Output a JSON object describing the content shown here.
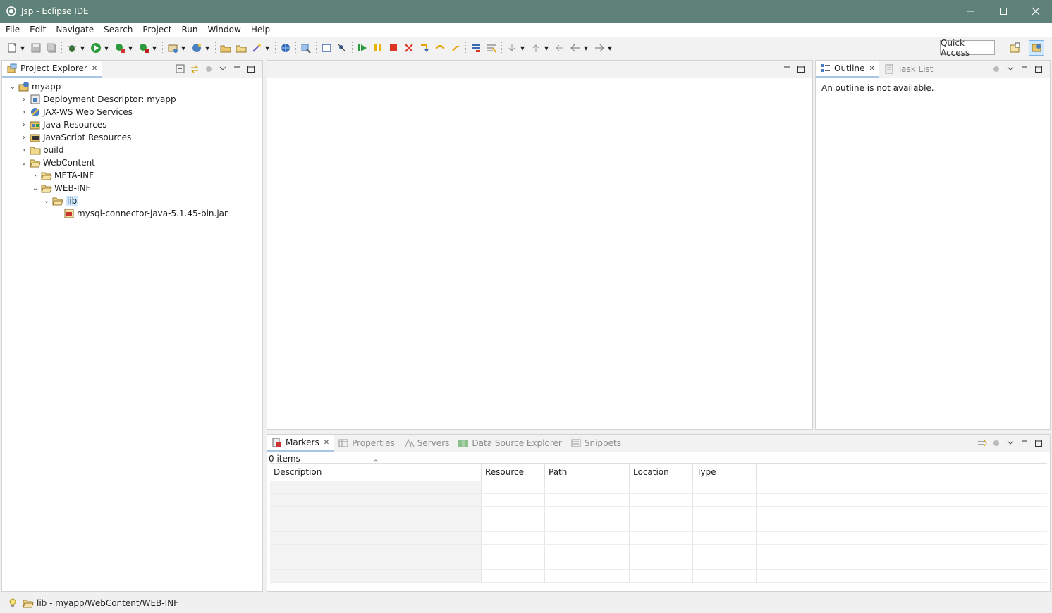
{
  "window": {
    "title": "Jsp - Eclipse IDE",
    "controls": [
      "minimize",
      "maximize",
      "close"
    ]
  },
  "menu": [
    "File",
    "Edit",
    "Navigate",
    "Search",
    "Project",
    "Run",
    "Window",
    "Help"
  ],
  "toolbar": {
    "quick_access": "Quick Access"
  },
  "project_explorer": {
    "tab_label": "Project Explorer",
    "tree": [
      {
        "label": "myapp",
        "depth": 0,
        "expanded": true,
        "icon": "project-icon"
      },
      {
        "label": "Deployment Descriptor: myapp",
        "depth": 1,
        "expanded": false,
        "icon": "descriptor-icon"
      },
      {
        "label": "JAX-WS Web Services",
        "depth": 1,
        "expanded": false,
        "icon": "webservice-icon"
      },
      {
        "label": "Java Resources",
        "depth": 1,
        "expanded": false,
        "icon": "java-resources-icon"
      },
      {
        "label": "JavaScript Resources",
        "depth": 1,
        "expanded": false,
        "icon": "js-resources-icon"
      },
      {
        "label": "build",
        "depth": 1,
        "expanded": false,
        "icon": "folder-icon"
      },
      {
        "label": "WebContent",
        "depth": 1,
        "expanded": true,
        "icon": "folder-open-icon"
      },
      {
        "label": "META-INF",
        "depth": 2,
        "expanded": false,
        "icon": "folder-icon"
      },
      {
        "label": "WEB-INF",
        "depth": 2,
        "expanded": true,
        "icon": "folder-open-icon"
      },
      {
        "label": "lib",
        "depth": 3,
        "expanded": true,
        "icon": "folder-open-icon",
        "selected": true
      },
      {
        "label": "mysql-connector-java-5.1.45-bin.jar",
        "depth": 4,
        "expanded": null,
        "icon": "jar-icon"
      }
    ]
  },
  "outline": {
    "tabs": [
      {
        "label": "Outline",
        "active": true
      },
      {
        "label": "Task List",
        "active": false
      }
    ],
    "message": "An outline is not available."
  },
  "bottom_panel": {
    "tabs": [
      {
        "label": "Markers",
        "active": true
      },
      {
        "label": "Properties",
        "active": false
      },
      {
        "label": "Servers",
        "active": false
      },
      {
        "label": "Data Source Explorer",
        "active": false
      },
      {
        "label": "Snippets",
        "active": false
      }
    ],
    "item_count": "0 items",
    "columns": [
      "Description",
      "Resource",
      "Path",
      "Location",
      "Type"
    ],
    "empty_rows": 8
  },
  "status_bar": {
    "text": "lib - myapp/WebContent/WEB-INF"
  },
  "colors": {
    "titlebar": "#5e8277",
    "selection": "#cde8ff",
    "active_tab_underline": "#a9c5e6"
  }
}
